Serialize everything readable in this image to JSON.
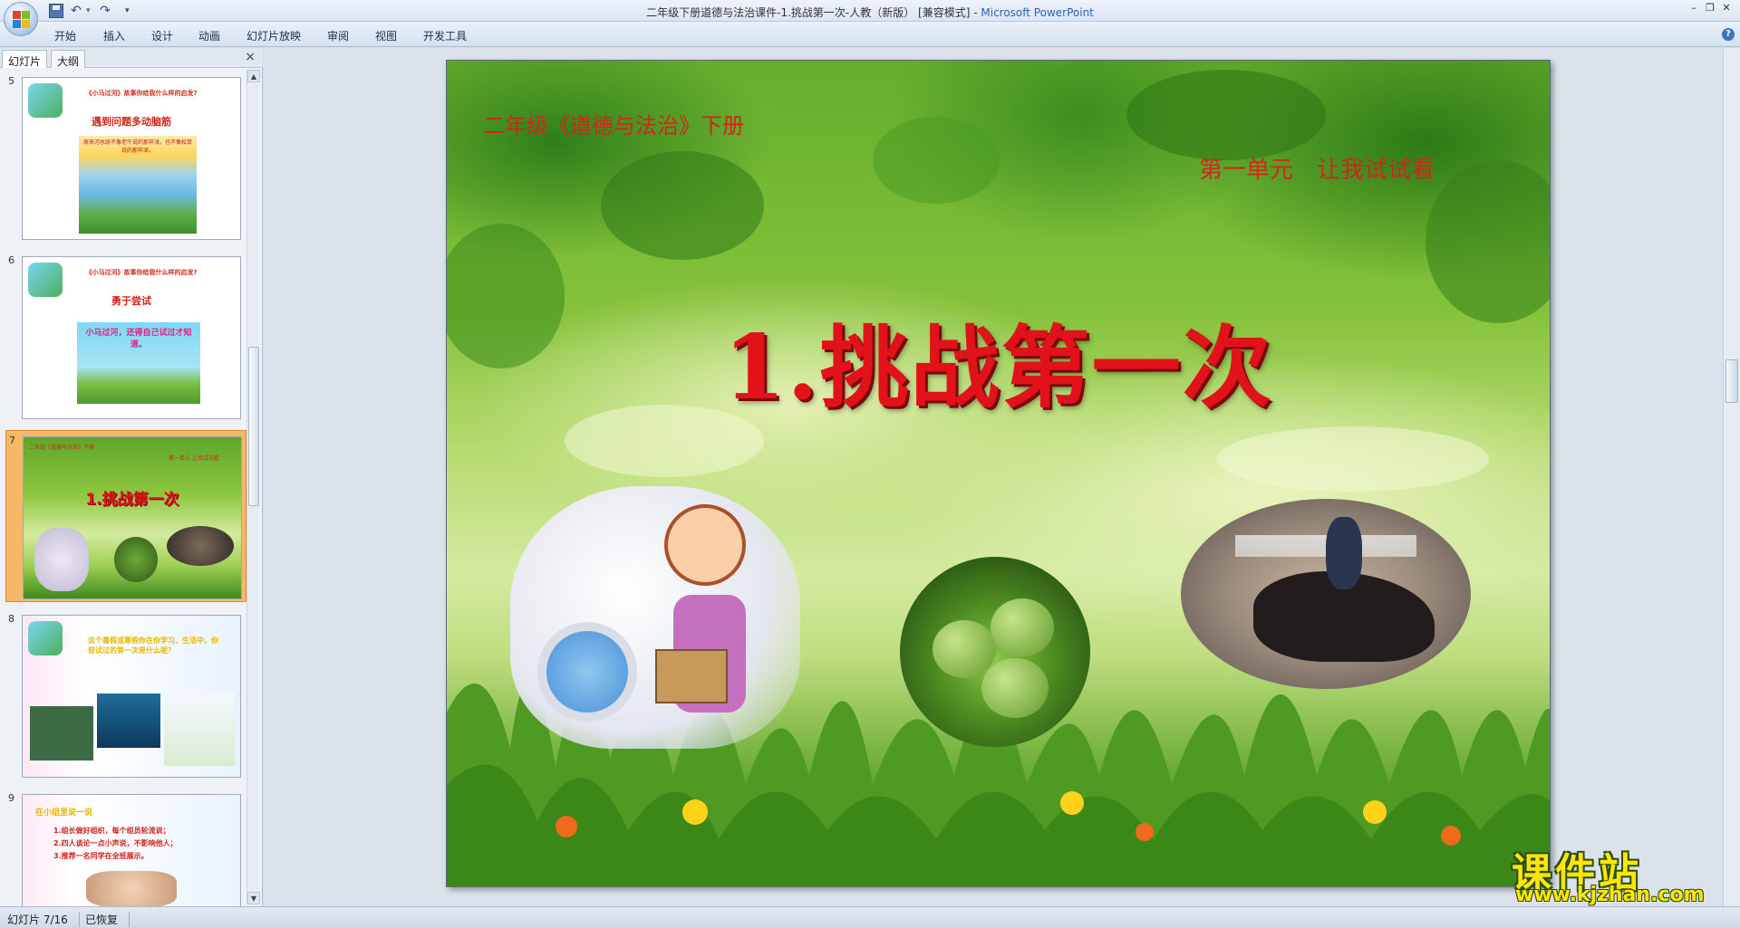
{
  "window": {
    "title_doc": "二年级下册道德与法治课件-1.挑战第一次-人教（新版） [兼容模式] - ",
    "title_app": "Microsoft PowerPoint"
  },
  "ribbon": {
    "tabs": [
      "开始",
      "插入",
      "设计",
      "动画",
      "幻灯片放映",
      "审阅",
      "视图",
      "开发工具"
    ]
  },
  "left_pane": {
    "tabs": [
      "幻灯片",
      "大纲"
    ],
    "close": "×",
    "slides": [
      {
        "num": "5",
        "head": "《小马过河》故事你给我什么样的启发?",
        "sub": "遇到问题多动脑筋",
        "note": "原来河水既不像老牛说的那样浅，也不像松鼠说的那样深。"
      },
      {
        "num": "6",
        "head": "《小马过河》故事你给我什么样的启发?",
        "sub": "勇于尝试",
        "note": "小马过河，还得自己试过才知道。"
      },
      {
        "num": "7",
        "head_left": "二年级《道德与法治》下册",
        "head_right": "第一单元  让我试试看",
        "sub": "1.挑战第一次"
      },
      {
        "num": "8",
        "head": "这个暑假或寒假你在你学习、生活中，你尝试过的第一次是什么呢？"
      },
      {
        "num": "9",
        "head": "在小组里说一说",
        "lines": [
          "1.组长做好组织，每个组员轮流说；",
          "2.四人谈论一点小声说，不影响他人；",
          "3.推荐一名同学在全班展示。"
        ]
      }
    ]
  },
  "slide": {
    "top_left": "二年级《道德与法治》下册",
    "top_right": "第一单元　让我试试看",
    "title": "1.挑战第一次"
  },
  "status": {
    "slide_pos": "幻灯片 7/16",
    "state": "已恢复"
  },
  "watermark": {
    "big": "课件站",
    "small": "www.kjzhan.com"
  },
  "colors": {
    "title_red": "#e2121a",
    "selection": "#f6b866"
  }
}
